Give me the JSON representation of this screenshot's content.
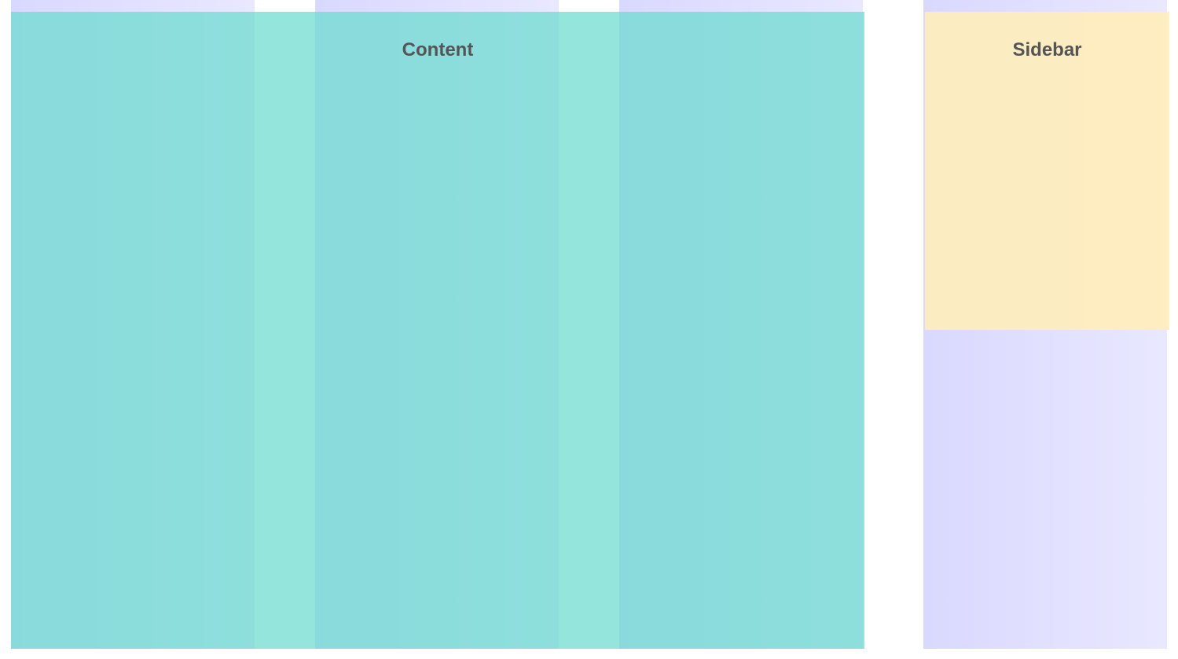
{
  "layout_demo": {
    "content": {
      "heading": "Content"
    },
    "sidebar": {
      "heading": "Sidebar"
    }
  },
  "colors": {
    "grid_column": "#dedcff",
    "content_background": "#89dbd9",
    "sidebar_background": "#f4e3c1",
    "heading_text": "#555555"
  }
}
